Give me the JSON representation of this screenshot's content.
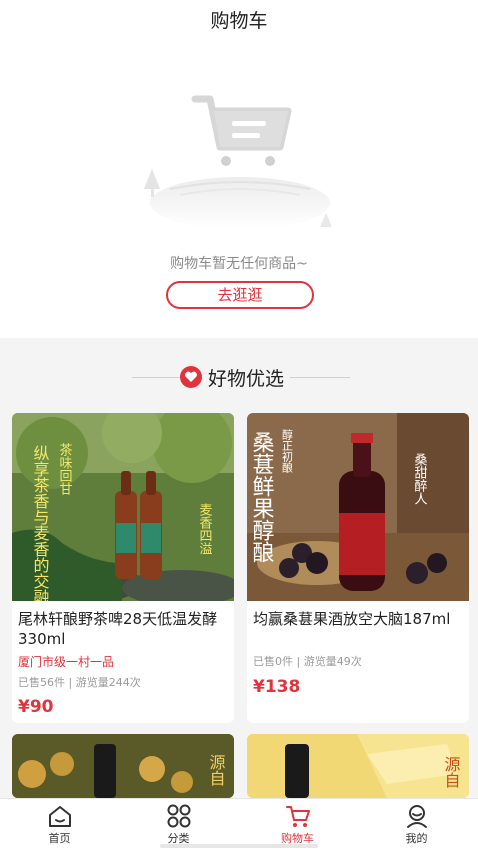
{
  "header": {
    "title": "购物车"
  },
  "empty": {
    "message": "购物车暂无任何商品~",
    "button": "去逛逛"
  },
  "recommend": {
    "title": "好物优选",
    "products": [
      {
        "name": "尾林轩酿野茶啤28天低温发酵330ml",
        "tag": "厦门市级一村一品",
        "stats": "已售56件 | 游览量244次",
        "price": "¥90",
        "img_text_a": "纵享茶香与麦香的交融",
        "img_text_b": "茶味回甘",
        "img_text_c": "麦香四溢"
      },
      {
        "name": "均赢桑葚果酒放空大脑187ml",
        "tag": "",
        "stats": "已售0件 | 游览量49次",
        "price": "¥138",
        "img_text_a": "桑葚鲜果醇酿",
        "img_text_b": "醇正初酿",
        "img_text_c": "桑甜醉人"
      }
    ],
    "partial_labels": [
      "源自",
      "源自"
    ]
  },
  "tabbar": [
    {
      "label": "首页",
      "icon": "home-icon"
    },
    {
      "label": "分类",
      "icon": "category-icon"
    },
    {
      "label": "购物车",
      "icon": "cart-icon",
      "active": true
    },
    {
      "label": "我的",
      "icon": "profile-icon"
    }
  ],
  "colors": {
    "accent": "#e0333b"
  }
}
